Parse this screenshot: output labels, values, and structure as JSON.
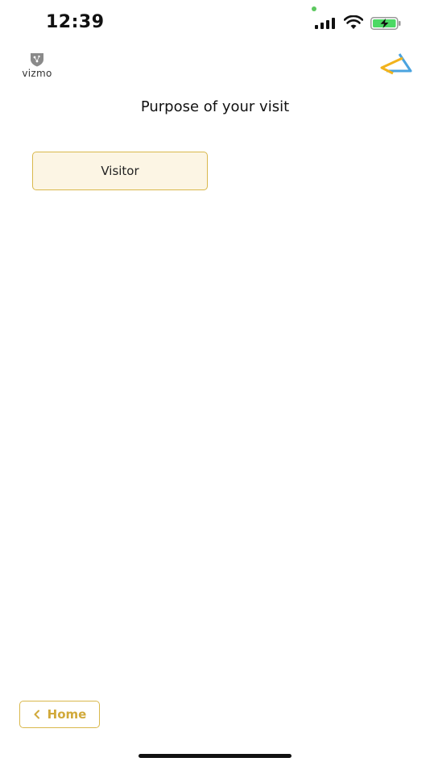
{
  "status_bar": {
    "time": "12:39",
    "icons": [
      "signal-icon",
      "wifi-icon",
      "battery-charging-icon"
    ],
    "battery_color": "#4cd964"
  },
  "header": {
    "left_logo_text": "vizmo",
    "left_logo_icon": "vizmo-shield-logo",
    "right_logo_icon": "triangle-brand-logo"
  },
  "main": {
    "title": "Purpose of your visit",
    "options": [
      {
        "label": "Visitor"
      }
    ]
  },
  "footer": {
    "home_label": "Home",
    "home_icon": "chevron-left-icon"
  },
  "colors": {
    "accent": "#d9b84c",
    "accent_text": "#d1a93a",
    "option_bg": "#fcf5e4"
  }
}
